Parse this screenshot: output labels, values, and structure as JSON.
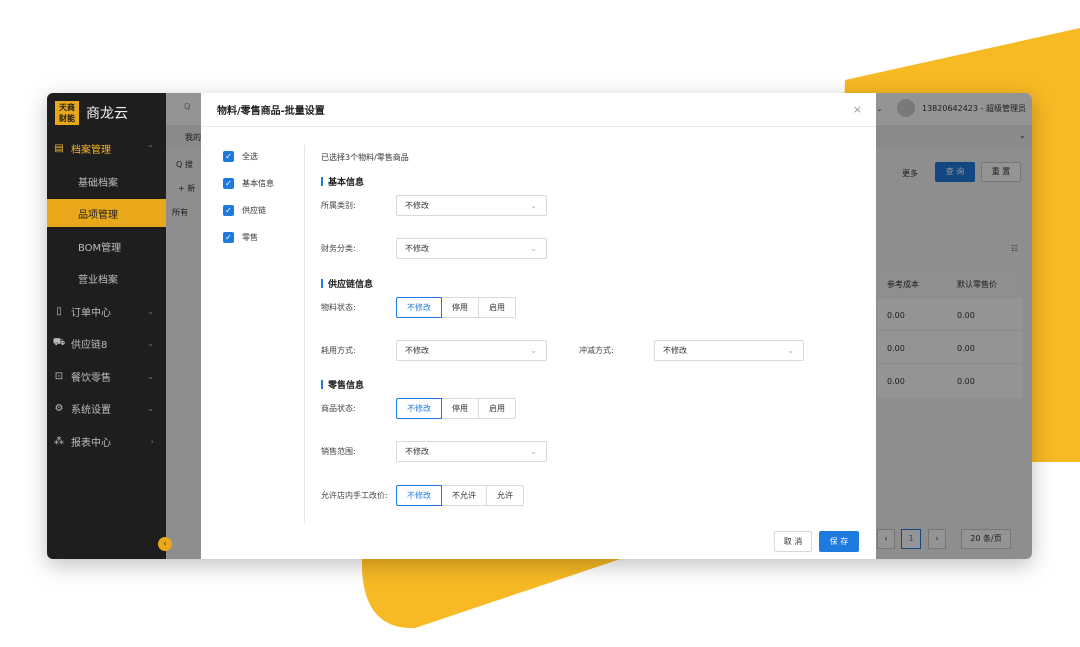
{
  "brand": {
    "logo_text": "天商\n财能",
    "name": "商龙云"
  },
  "sidebar": {
    "items": [
      {
        "icon": "archive-icon",
        "label": "档案管理",
        "glyph": "▤",
        "expanded": true
      },
      {
        "label": "基础档案"
      },
      {
        "label": "品项管理",
        "selected": true
      },
      {
        "label": "BOM管理"
      },
      {
        "label": "营业档案"
      },
      {
        "icon": "order-icon",
        "label": "订单中心",
        "glyph": "▯"
      },
      {
        "icon": "truck-icon",
        "label": "供应链8",
        "glyph": "⛟"
      },
      {
        "icon": "cart-icon",
        "label": "餐饮零售",
        "glyph": "⊡"
      },
      {
        "icon": "gear-icon",
        "label": "系统设置",
        "glyph": "⚙"
      },
      {
        "icon": "report-icon",
        "label": "报表中心",
        "glyph": "⁂"
      }
    ]
  },
  "header": {
    "user": "13820642423 - 超级管理员"
  },
  "tabs": {
    "first": "我的"
  },
  "background": {
    "search_label": "Q 搜",
    "add_label": "+ 新",
    "tree_all": "所有",
    "more_label": "更多",
    "query_button": "查 询",
    "reset_button": "重 置",
    "columns": [
      "参考成本",
      "默认零售价"
    ],
    "rows": [
      [
        "0.00",
        "0.00"
      ],
      [
        "0.00",
        "0.00"
      ],
      [
        "0.00",
        "0.00"
      ]
    ],
    "page": "1",
    "page_size": "20 条/页"
  },
  "modal": {
    "title": "物料/零售商品-批量设置",
    "close": "×",
    "checklist": [
      "全选",
      "基本信息",
      "供应链",
      "零售"
    ],
    "selected_note": "已选择3个物料/零售商品",
    "sections": {
      "basic": "基本信息",
      "supply": "供应链信息",
      "retail": "零售信息"
    },
    "fields": {
      "category_label": "所属类别:",
      "category_value": "不修改",
      "finance_label": "财务分类:",
      "finance_value": "不修改",
      "material_status_label": "物料状态:",
      "material_status_options": [
        "不修改",
        "停用",
        "启用"
      ],
      "consume_label": "耗用方式:",
      "consume_value": "不修改",
      "writeoff_label": "冲减方式:",
      "writeoff_value": "不修改",
      "product_status_label": "商品状态:",
      "product_status_options": [
        "不修改",
        "停用",
        "启用"
      ],
      "sales_scope_label": "销售范围:",
      "sales_scope_value": "不修改",
      "manual_price_label": "允许店内手工改价:",
      "manual_price_options": [
        "不修改",
        "不允许",
        "允许"
      ]
    },
    "cancel": "取 消",
    "save": "保 存"
  },
  "colors": {
    "accent": "#1f7ae0",
    "brand": "#e9a81a",
    "decor": "#f7b924"
  }
}
